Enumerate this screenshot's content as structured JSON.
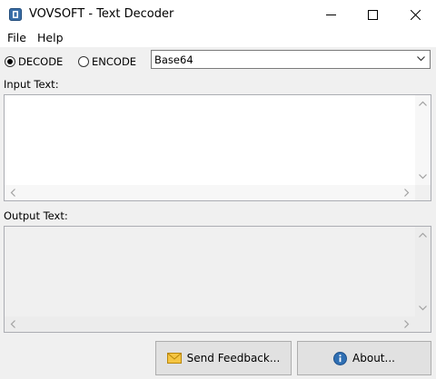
{
  "window": {
    "title": "VOVSOFT - Text Decoder"
  },
  "menu": {
    "file": "File",
    "help": "Help"
  },
  "mode": {
    "decode_label": "DECODE",
    "encode_label": "ENCODE",
    "selected": "decode"
  },
  "encoding": {
    "selected": "Base64"
  },
  "input": {
    "label": "Input Text:",
    "value": ""
  },
  "output": {
    "label": "Output Text:",
    "value": ""
  },
  "buttons": {
    "feedback": "Send Feedback...",
    "about": "About..."
  },
  "colors": {
    "info_icon": "#2f6fb3",
    "mail_icon": "#f5c542",
    "window_bg": "#f0f0f0"
  }
}
